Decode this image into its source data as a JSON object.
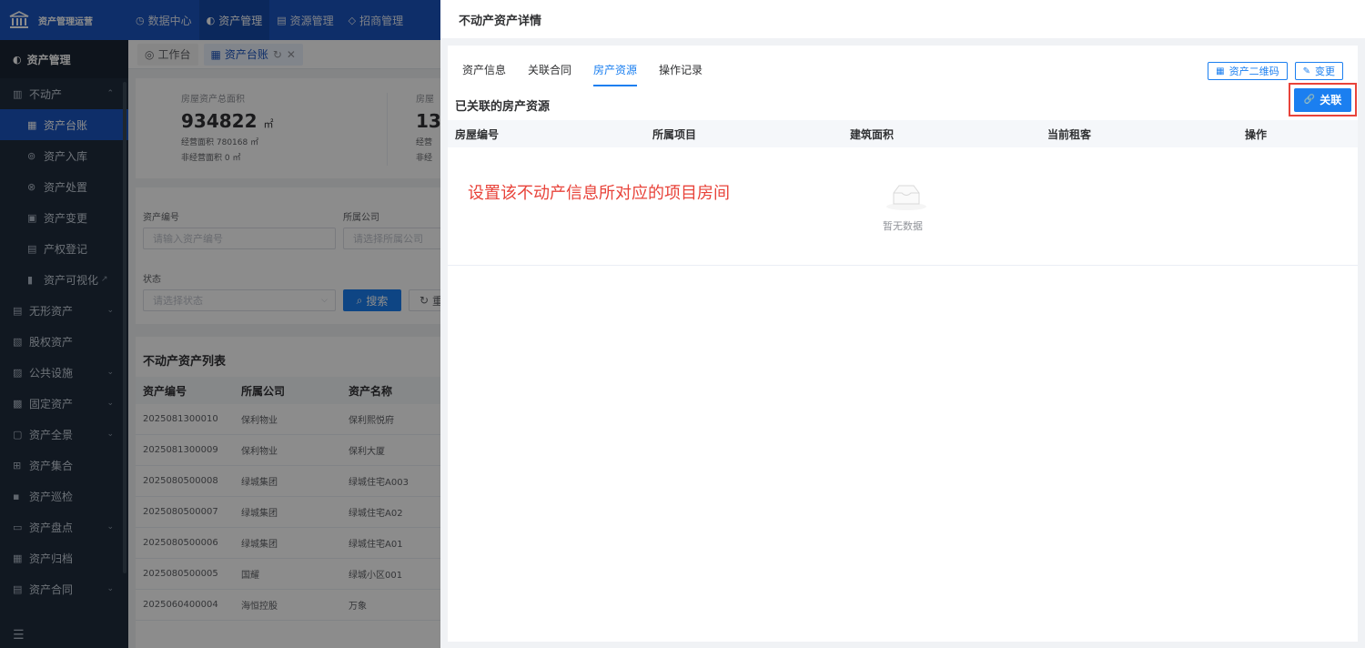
{
  "topbar": {
    "brand": "资产管理运营",
    "nav": [
      {
        "label": "数据中心",
        "icon": "clock-icon"
      },
      {
        "label": "资产管理",
        "icon": "pie-icon",
        "active": true
      },
      {
        "label": "资源管理",
        "icon": "building-icon"
      },
      {
        "label": "招商管理",
        "icon": "diamond-icon"
      }
    ]
  },
  "sidebar": {
    "header": "资产管理",
    "items": [
      {
        "label": "不动产",
        "icon": "building-icon",
        "chevron": "^",
        "sub": false
      },
      {
        "label": "资产台账",
        "icon": "ledger-icon",
        "sub": true,
        "active": true
      },
      {
        "label": "资产入库",
        "icon": "inbox-icon",
        "sub": true
      },
      {
        "label": "资产处置",
        "icon": "dispose-icon",
        "sub": true
      },
      {
        "label": "资产变更",
        "icon": "change-icon",
        "sub": true
      },
      {
        "label": "产权登记",
        "icon": "register-icon",
        "sub": true
      },
      {
        "label": "资产可视化",
        "icon": "chart-icon",
        "sub": true,
        "external": true
      },
      {
        "label": "无形资产",
        "icon": "doc-icon",
        "chevron": "v",
        "sub": false
      },
      {
        "label": "股权资产",
        "icon": "equity-icon",
        "sub": false
      },
      {
        "label": "公共设施",
        "icon": "facility-icon",
        "chevron": "v",
        "sub": false
      },
      {
        "label": "固定资产",
        "icon": "fixed-icon",
        "chevron": "v",
        "sub": false
      },
      {
        "label": "资产全景",
        "icon": "panorama-icon",
        "chevron": "v",
        "sub": false
      },
      {
        "label": "资产集合",
        "icon": "grid-icon",
        "sub": false
      },
      {
        "label": "资产巡检",
        "icon": "inspect-icon",
        "sub": false
      },
      {
        "label": "资产盘点",
        "icon": "stock-icon",
        "chevron": "v",
        "sub": false
      },
      {
        "label": "资产归档",
        "icon": "archive-icon",
        "sub": false
      },
      {
        "label": "资产合同",
        "icon": "contract-icon",
        "chevron": "v",
        "sub": false
      }
    ]
  },
  "worktabs": [
    {
      "label": "工作台",
      "active": false
    },
    {
      "label": "资产台账",
      "active": true
    }
  ],
  "stats": {
    "label1": "房屋资产总面积",
    "value1": "934822",
    "unit1": "㎡",
    "sub1a": "经营面积 780168 ㎡",
    "sub1b": "非经营面积 0 ㎡",
    "label2": "房屋",
    "value2": "13",
    "sub2a": "经营",
    "sub2b": "非经"
  },
  "filters": {
    "asset_no_label": "资产编号",
    "asset_no_placeholder": "请输入资产编号",
    "company_label": "所属公司",
    "company_placeholder": "请选择所属公司",
    "status_label": "状态",
    "status_placeholder": "请选择状态",
    "search_label": "搜索",
    "reset_label": "重"
  },
  "list": {
    "title": "不动产资产列表",
    "columns": [
      "资产编号",
      "所属公司",
      "资产名称"
    ],
    "rows": [
      [
        "2025081300010",
        "保利物业",
        "保利熙悦府"
      ],
      [
        "2025081300009",
        "保利物业",
        "保利大厦"
      ],
      [
        "2025080500008",
        "绿城集团",
        "绿城住宅A003"
      ],
      [
        "2025080500007",
        "绿城集团",
        "绿城住宅A02"
      ],
      [
        "2025080500006",
        "绿城集团",
        "绿城住宅A01"
      ],
      [
        "2025080500005",
        "国耀",
        "绿城小区001"
      ],
      [
        "2025060400004",
        "海恒控股",
        "万象"
      ]
    ]
  },
  "drawer": {
    "title": "不动产资产详情",
    "tabs": [
      "资产信息",
      "关联合同",
      "房产资源",
      "操作记录"
    ],
    "active_tab": 2,
    "qrcode_label": "资产二维码",
    "change_label": "变更",
    "section_title": "已关联的房产资源",
    "link_label": "关联",
    "columns": [
      "房屋编号",
      "所属项目",
      "建筑面积",
      "当前租客",
      "操作"
    ],
    "empty_text": "暂无数据",
    "annotation": "设置该不动产信息所对应的项目房间"
  },
  "colors": {
    "primary": "#1b55c0",
    "accent": "#1b7ff0",
    "sidebar_bg": "#1f2d3d",
    "highlight_red": "#e8433a"
  }
}
